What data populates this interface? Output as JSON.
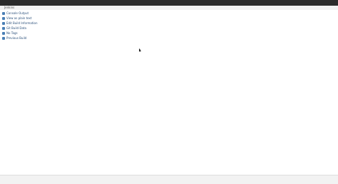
{
  "window": {
    "title": ""
  },
  "breadcrumb": {
    "items": [
      "Jenkins",
      "",
      ""
    ]
  },
  "sidebar": {
    "items": [
      {
        "label": "Console Output"
      },
      {
        "label": "View as plain text"
      },
      {
        "label": "Edit Build Information"
      },
      {
        "label": "Git Build Data"
      },
      {
        "label": "No Tags"
      },
      {
        "label": "Previous Build"
      }
    ]
  },
  "console": {
    "lines": []
  },
  "footer": {
    "items": [
      "",
      "",
      ""
    ]
  },
  "colors": {
    "topbar": "#2b2b2b",
    "link": "#2a4f7a",
    "text": "#333333"
  }
}
